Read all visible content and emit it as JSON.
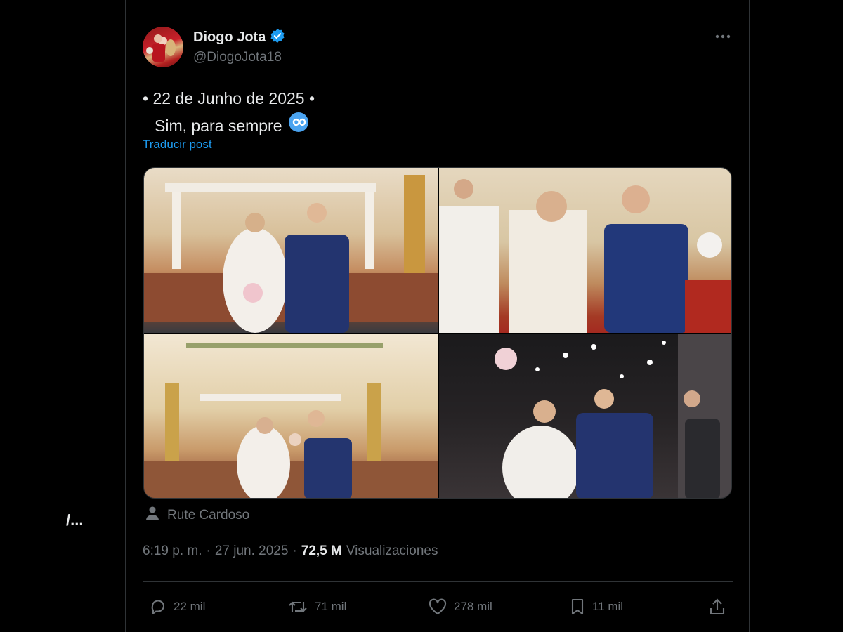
{
  "post": {
    "author_name": "Diogo Jota",
    "author_handle": "@DiogoJota18",
    "verified": true,
    "text_line1": "• 22 de Junho de 2025 •",
    "text_line2": "Sim, para sempre",
    "text_emoji": "infinity-emoji",
    "translate_label": "Traducir post",
    "tagged_user": "Rute Cardoso",
    "time": "6:19 p. m.",
    "separator": "·",
    "date": "27 jun. 2025",
    "views_count": "72,5 M",
    "views_label": "Visualizaciones",
    "media_count": 4
  },
  "actions": {
    "replies": "22 mil",
    "reposts": "71 mil",
    "likes": "278 mil",
    "bookmarks": "11 mil"
  },
  "side_text": "/...",
  "colors": {
    "background": "#000000",
    "text": "#e7e9ea",
    "secondary": "#71767b",
    "accent": "#1d9bf0",
    "border": "#2f3336"
  }
}
